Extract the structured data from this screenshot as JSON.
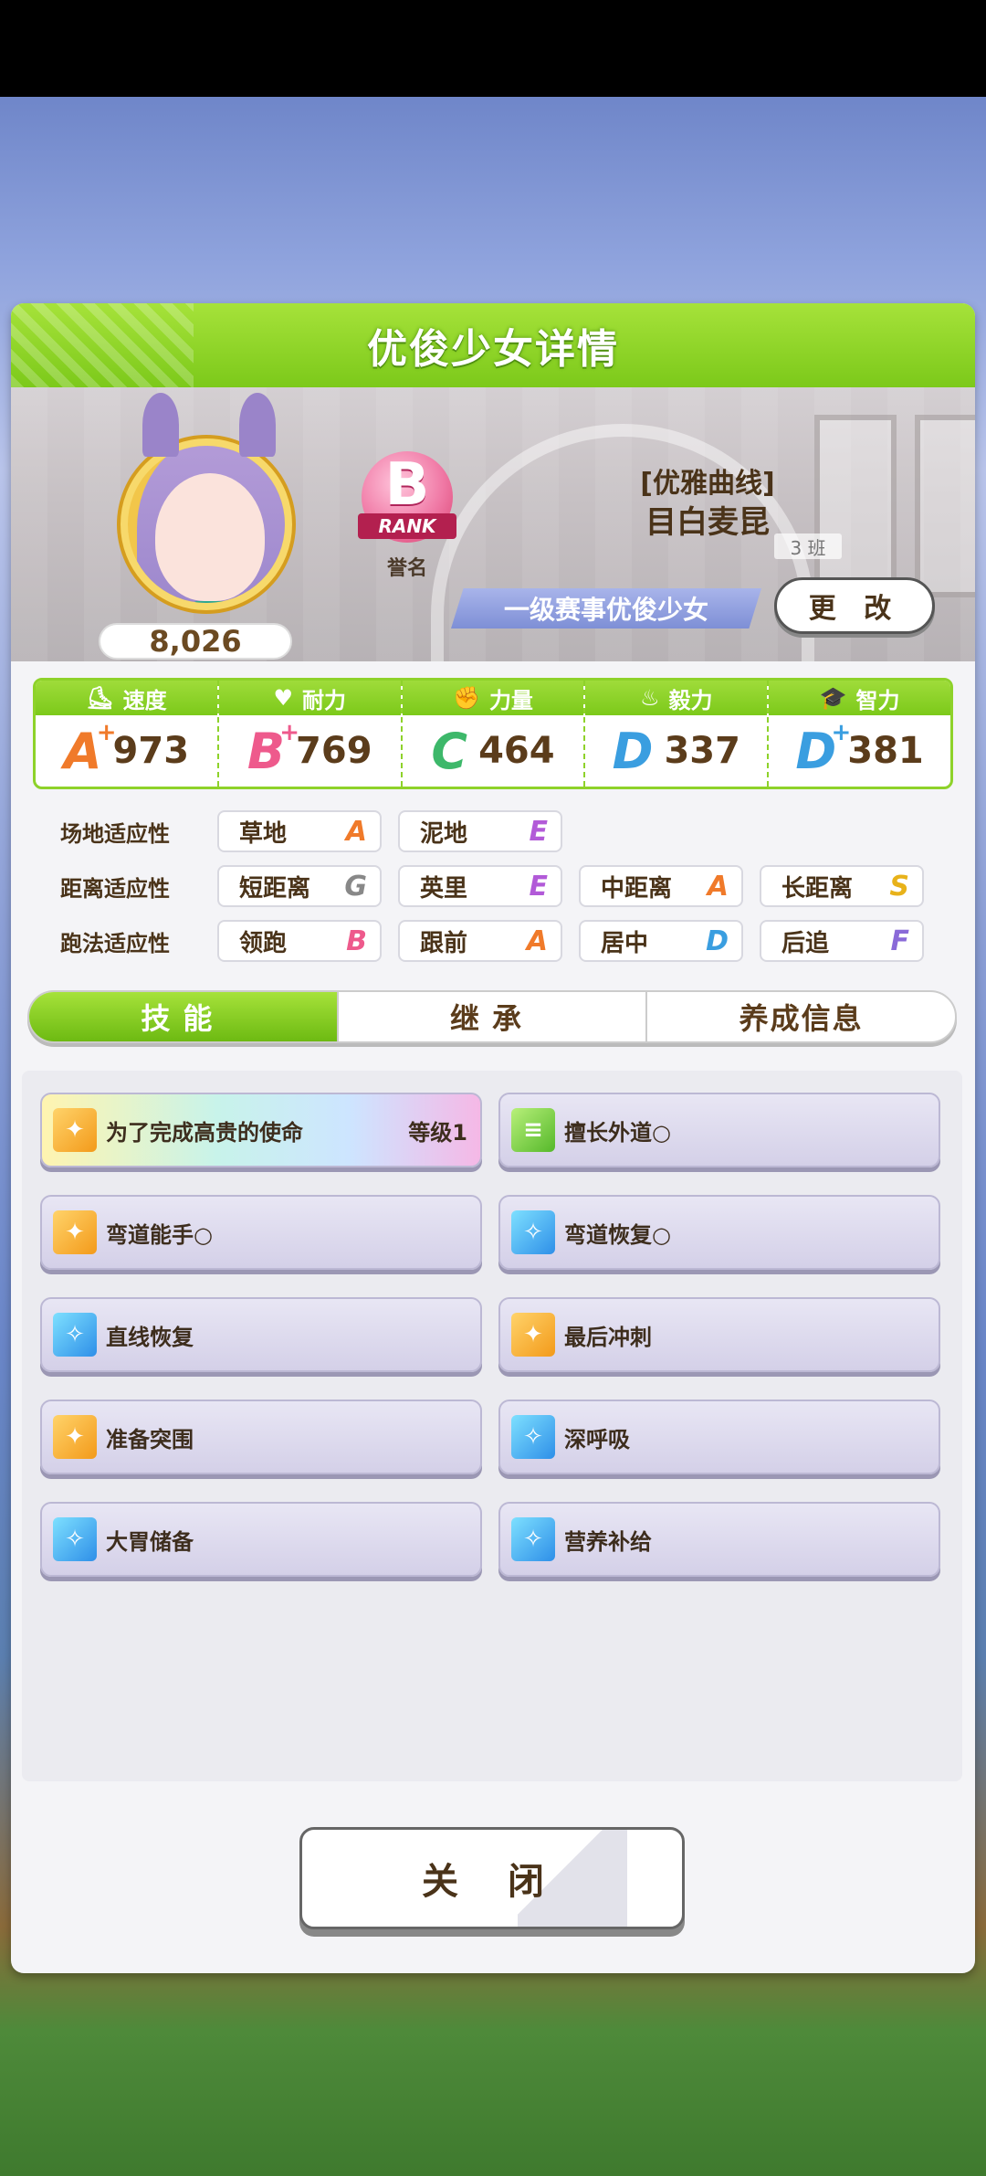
{
  "panel": {
    "title": "优俊少女详情"
  },
  "character": {
    "fans": "8,026",
    "rank_letter": "B",
    "rank_word": "RANK",
    "rank_caption": "誉名",
    "epithet": "[优雅曲线]",
    "name": "目白麦昆",
    "class_tag": "3 班",
    "title": "一级赛事优俊少女",
    "change_label": "更 改"
  },
  "stats": [
    {
      "label": "速度",
      "icon": "shoe-icon",
      "glyph": "⛸",
      "grade": "A",
      "plus": "+",
      "color": "#f07a2a",
      "value": "973"
    },
    {
      "label": "耐力",
      "icon": "heart-icon",
      "glyph": "♥",
      "grade": "B",
      "plus": "+",
      "color": "#ee5a8c",
      "value": "769"
    },
    {
      "label": "力量",
      "icon": "arm-icon",
      "glyph": "✊",
      "grade": "C",
      "plus": "",
      "color": "#3db86a",
      "value": "464"
    },
    {
      "label": "毅力",
      "icon": "flame-icon",
      "glyph": "♨",
      "grade": "D",
      "plus": "",
      "color": "#3a9ee0",
      "value": "337"
    },
    {
      "label": "智力",
      "icon": "graduation-cap-icon",
      "glyph": "🎓",
      "grade": "D",
      "plus": "+",
      "color": "#3a9ee0",
      "value": "381"
    }
  ],
  "aptitude": {
    "track_label": "场地适应性",
    "distance_label": "距离适应性",
    "style_label": "跑法适应性",
    "track": [
      {
        "name": "草地",
        "grade": "A",
        "color": "#f07a2a"
      },
      {
        "name": "泥地",
        "grade": "E",
        "color": "#b25ad8"
      }
    ],
    "distance": [
      {
        "name": "短距离",
        "grade": "G",
        "color": "#888888"
      },
      {
        "name": "英里",
        "grade": "E",
        "color": "#b25ad8"
      },
      {
        "name": "中距离",
        "grade": "A",
        "color": "#f07a2a"
      },
      {
        "name": "长距离",
        "grade": "S",
        "color": "#e8b21a"
      }
    ],
    "style": [
      {
        "name": "领跑",
        "grade": "B",
        "color": "#ee5a8c"
      },
      {
        "name": "跟前",
        "grade": "A",
        "color": "#f07a2a"
      },
      {
        "name": "居中",
        "grade": "D",
        "color": "#3a9ee0"
      },
      {
        "name": "后追",
        "grade": "F",
        "color": "#8a6ad8"
      }
    ]
  },
  "tabs": [
    "技能",
    "继承",
    "养成信息"
  ],
  "skills": [
    {
      "name": "为了完成高贵的使命",
      "level": "等级1",
      "icon": "runner-icon",
      "type": "gold"
    },
    {
      "name": "擅长外道○",
      "level": "",
      "icon": "document-icon",
      "type": "green"
    },
    {
      "name": "弯道能手○",
      "level": "",
      "icon": "runner-icon",
      "type": "gold"
    },
    {
      "name": "弯道恢复○",
      "level": "",
      "icon": "sparkle-icon",
      "type": "blue"
    },
    {
      "name": "直线恢复",
      "level": "",
      "icon": "sparkle-icon",
      "type": "blue"
    },
    {
      "name": "最后冲刺",
      "level": "",
      "icon": "runner-icon",
      "type": "gold"
    },
    {
      "name": "准备突围",
      "level": "",
      "icon": "runner-icon",
      "type": "gold"
    },
    {
      "name": "深呼吸",
      "level": "",
      "icon": "sparkle-icon",
      "type": "blue"
    },
    {
      "name": "大胃储备",
      "level": "",
      "icon": "sparkle-icon",
      "type": "blue"
    },
    {
      "name": "营养补给",
      "level": "",
      "icon": "sparkle-icon",
      "type": "blue"
    }
  ],
  "close_label": "关 闭"
}
